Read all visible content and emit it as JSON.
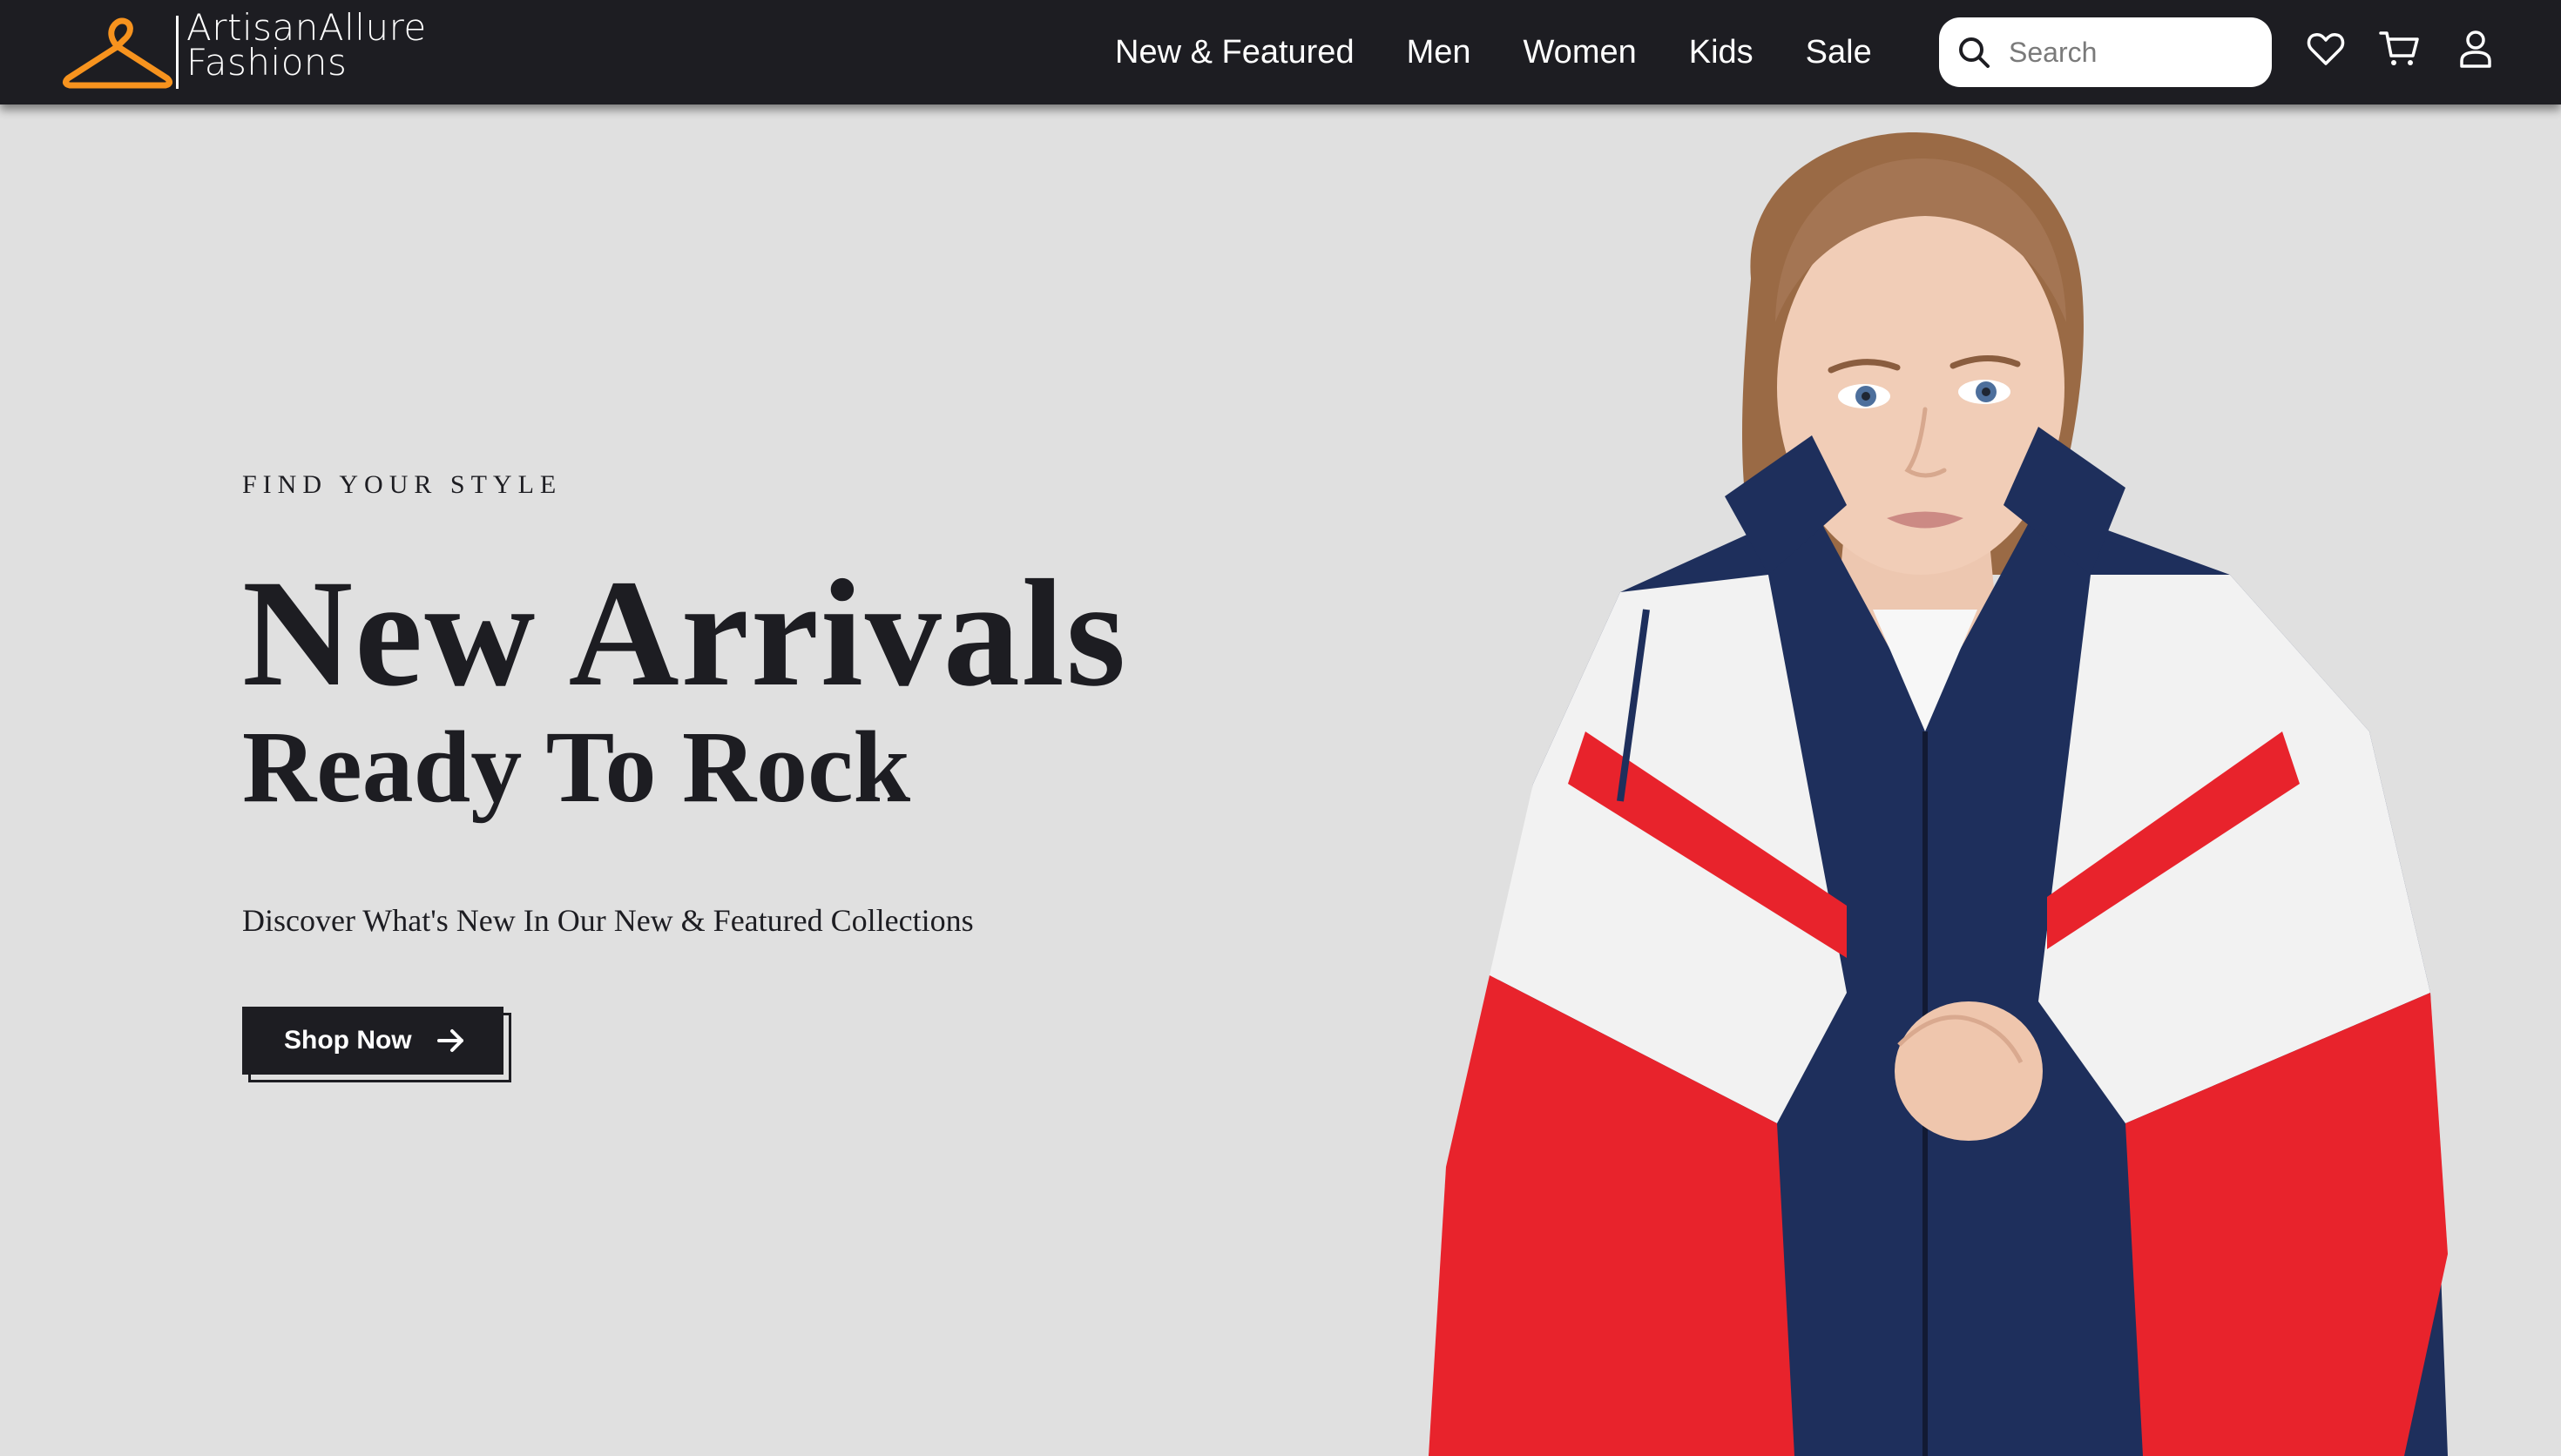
{
  "brand": {
    "line1": "ArtisanAllure",
    "line2": "Fashions",
    "accent_color": "#f7931e"
  },
  "nav": {
    "links": [
      {
        "label": "New & Featured"
      },
      {
        "label": "Men"
      },
      {
        "label": "Women"
      },
      {
        "label": "Kids"
      },
      {
        "label": "Sale"
      }
    ],
    "search_placeholder": "Search",
    "icons": [
      "heart-icon",
      "cart-icon",
      "user-icon"
    ]
  },
  "hero": {
    "eyebrow": "FIND YOUR STYLE",
    "headline": "New Arrivals",
    "subheadline": "Ready To Rock",
    "description": "Discover What's New In Our New & Featured Collections",
    "cta_label": "Shop Now"
  },
  "colors": {
    "navbar_bg": "#1d1d22",
    "page_bg": "#e0e0e0",
    "text_dark": "#1d1d22",
    "jacket_navy": "#1e2f5c",
    "jacket_red": "#e8232c",
    "jacket_white": "#f2f2f2"
  }
}
